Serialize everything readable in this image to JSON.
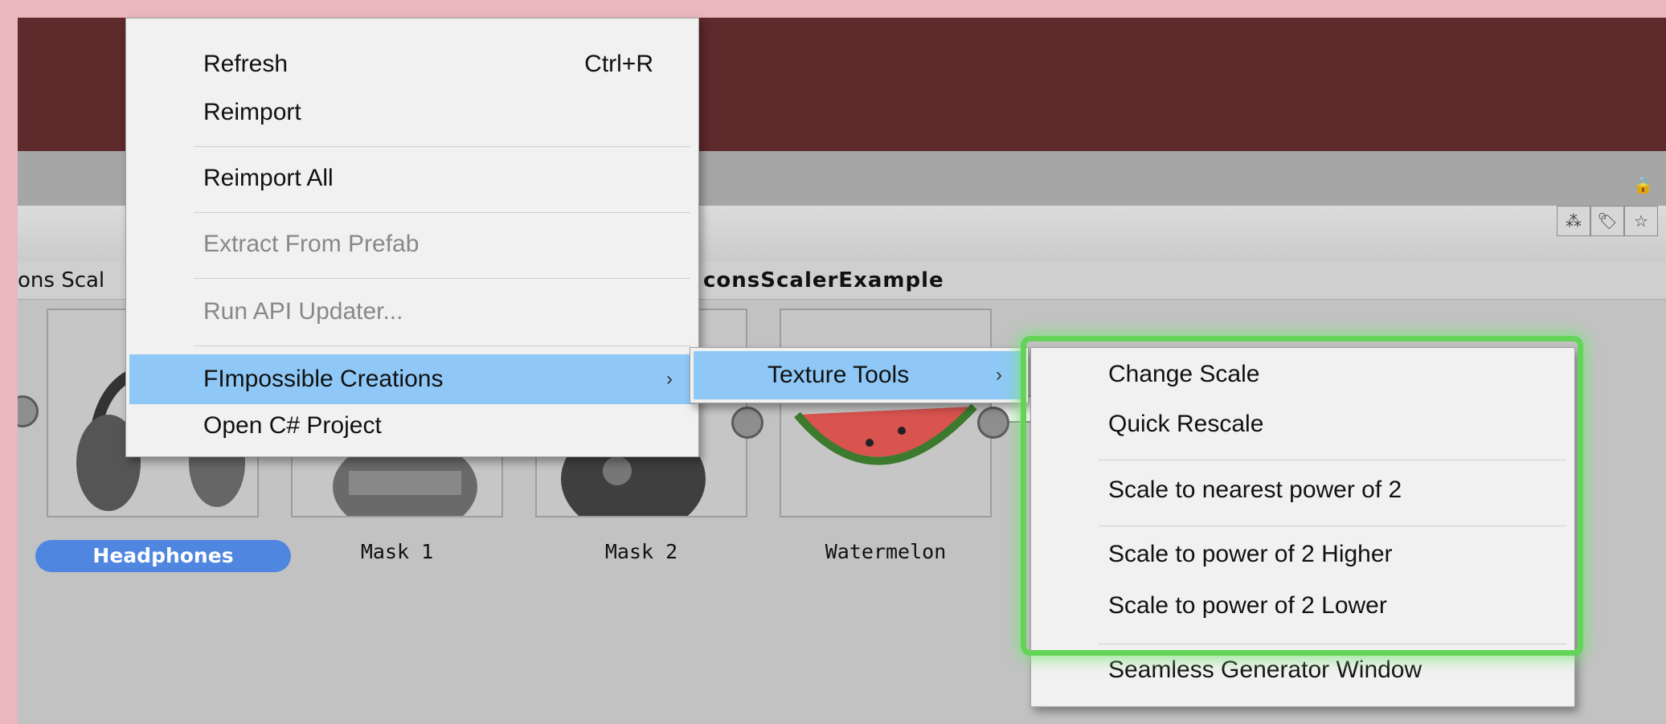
{
  "breadcrumb": {
    "left": "ons Scal",
    "right": "consScalerExample"
  },
  "search": {
    "icon": "search-icon",
    "value": ""
  },
  "assets": [
    {
      "label": "Headphones",
      "selected": true
    },
    {
      "label": "Mask 1",
      "selected": false
    },
    {
      "label": "Mask 2",
      "selected": false
    },
    {
      "label": "Watermelon",
      "selected": false
    }
  ],
  "context_menu": {
    "items": [
      {
        "label": "Refresh",
        "shortcut": "Ctrl+R"
      },
      {
        "label": "Reimport"
      },
      {
        "label": "Reimport All"
      },
      {
        "label": "Extract From Prefab",
        "disabled": true
      },
      {
        "label": "Run API Updater...",
        "disabled": true
      },
      {
        "label": "FImpossible Creations",
        "submenu": true,
        "highlighted": true
      },
      {
        "label": "Open C# Project"
      }
    ]
  },
  "submenu1": {
    "items": [
      {
        "label": "Texture Tools",
        "submenu": true,
        "highlighted": true
      }
    ]
  },
  "submenu2": {
    "items": [
      {
        "label": "Change Scale"
      },
      {
        "label": "Quick Rescale"
      },
      {
        "label": "Scale to nearest power of 2"
      },
      {
        "label": "Scale to power of 2 Higher"
      },
      {
        "label": "Scale to power of 2 Lower"
      },
      {
        "label": "Seamless Generator Window"
      }
    ]
  },
  "colors": {
    "highlight": "#8fc8f6",
    "selection": "#4f86e0",
    "glow": "#63d457",
    "titlebar": "#5e2a2c"
  }
}
